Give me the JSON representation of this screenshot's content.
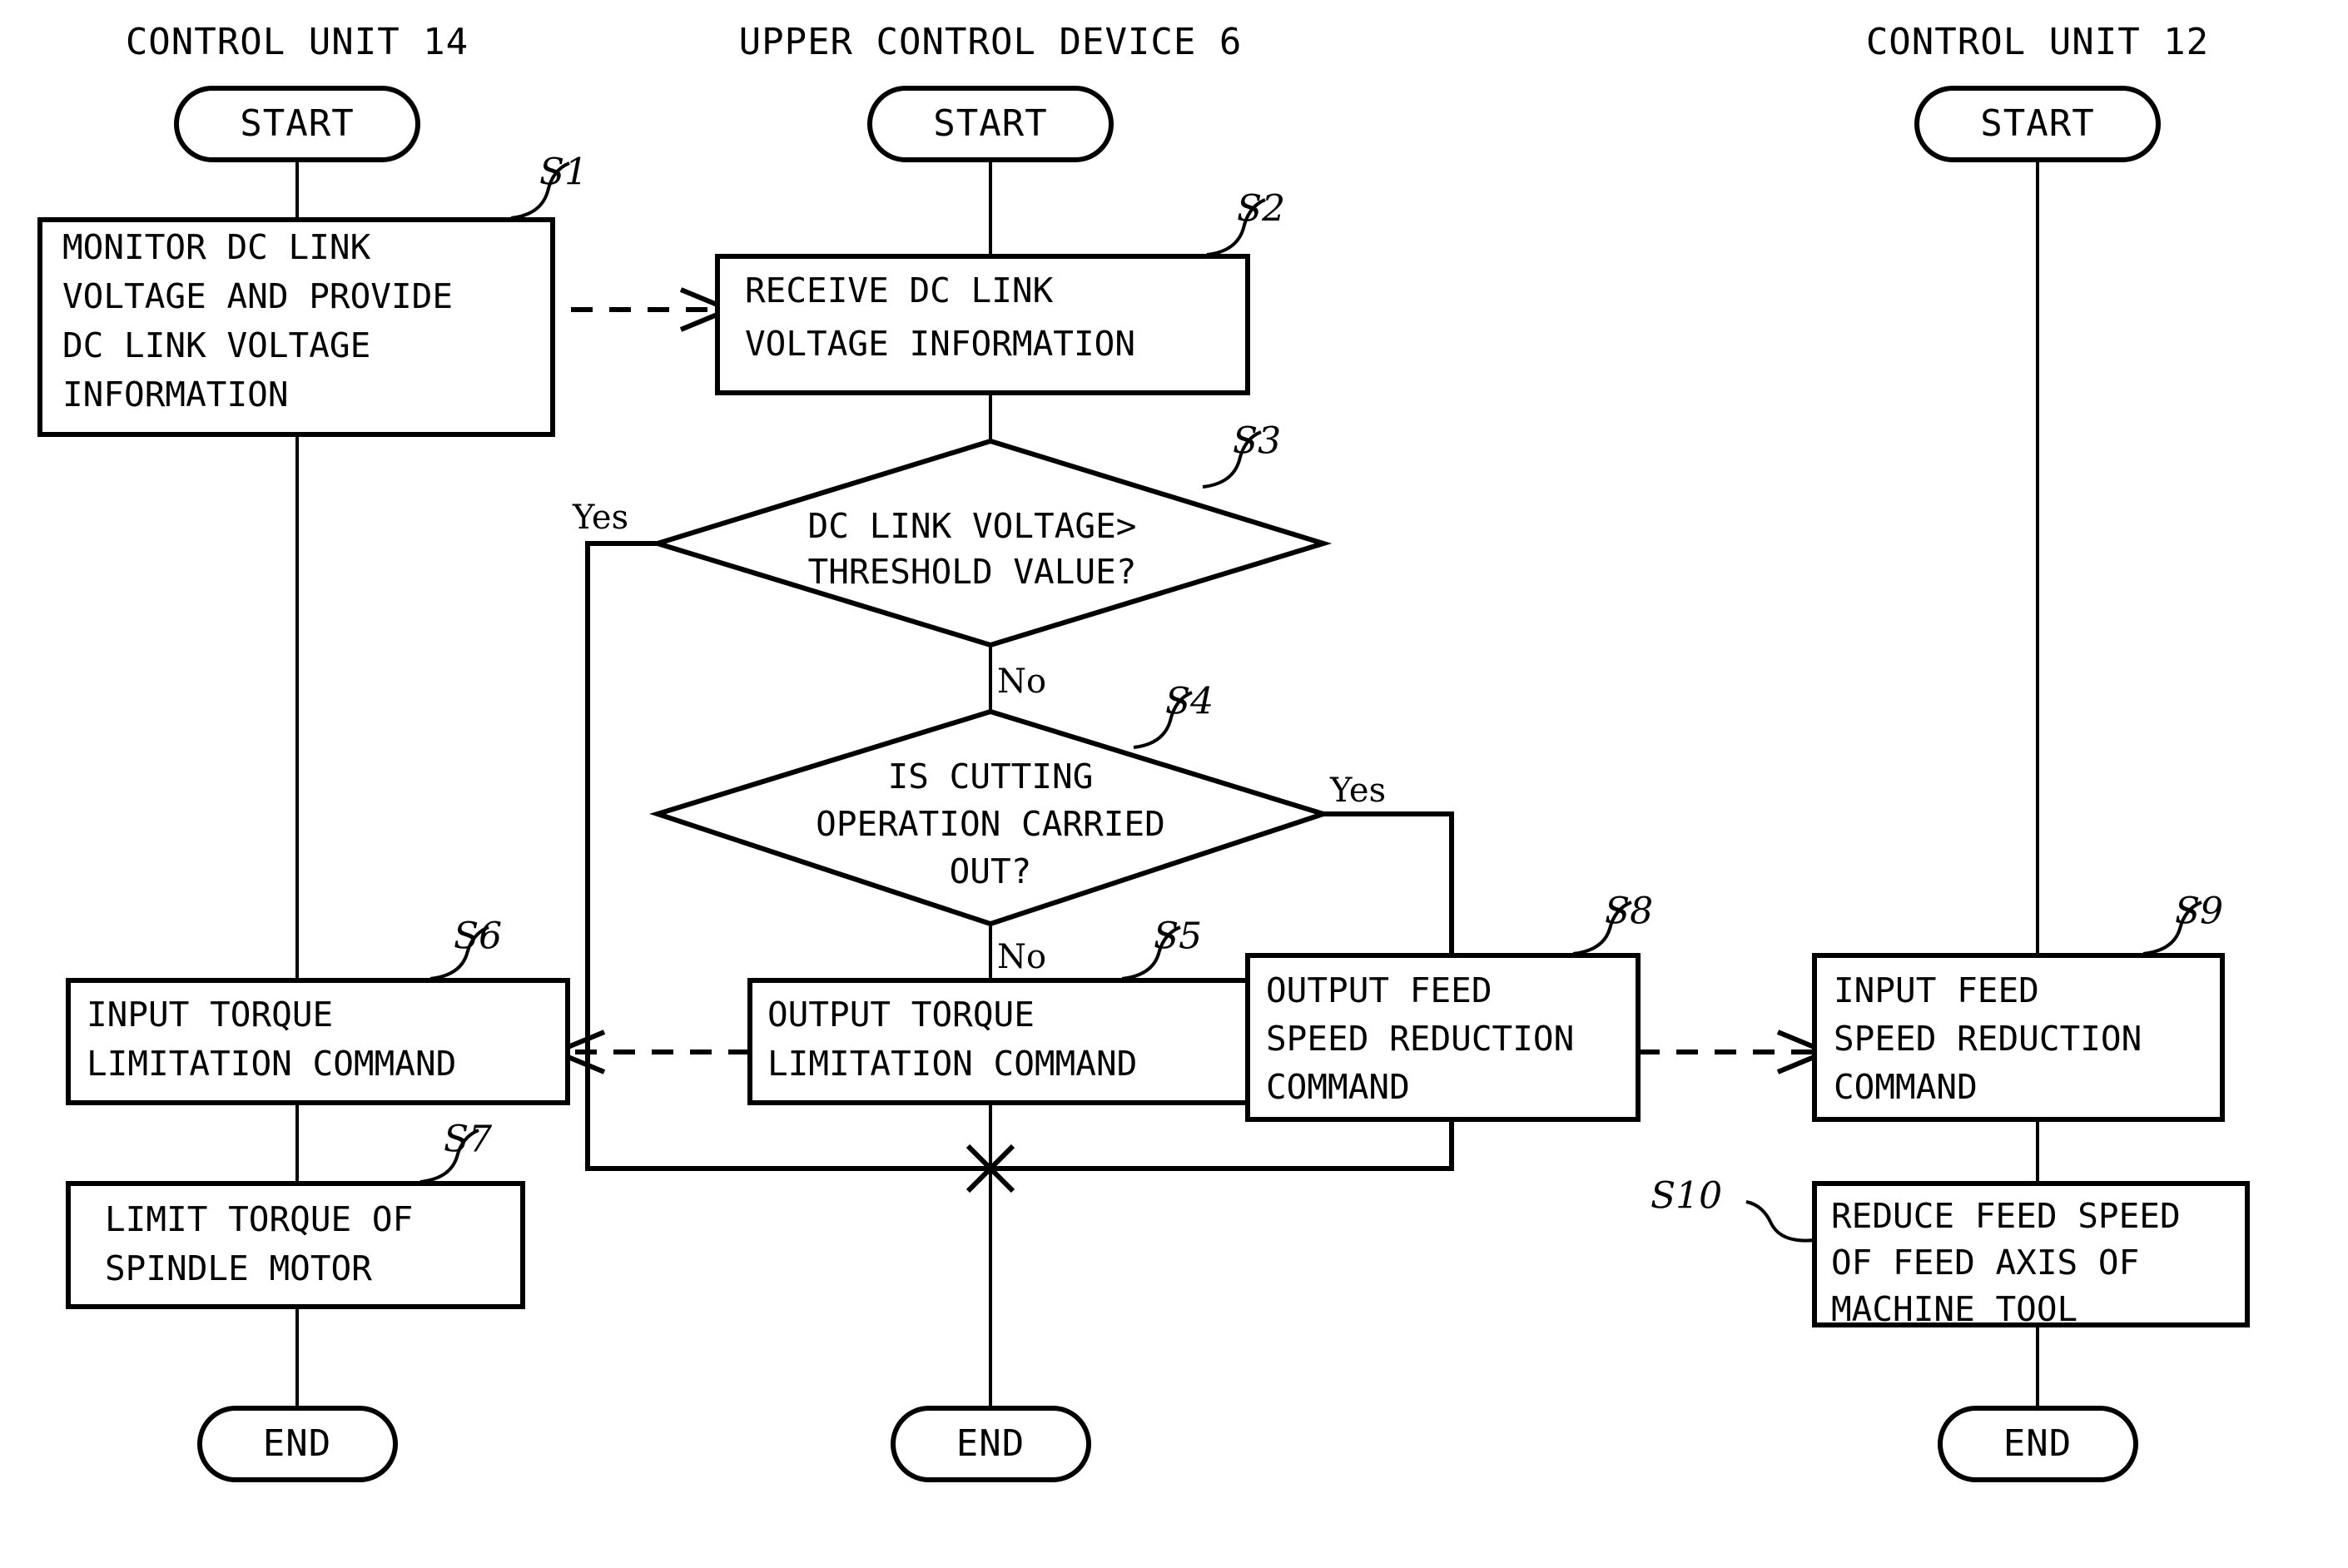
{
  "diagram": {
    "type": "flowchart",
    "title": "Patent flowchart: DC link voltage monitoring and torque/feed-speed limitation",
    "lanes": [
      {
        "id": "lane-left",
        "header": "CONTROL UNIT 14"
      },
      {
        "id": "lane-middle",
        "header": "UPPER CONTROL DEVICE 6"
      },
      {
        "id": "lane-right",
        "header": "CONTROL UNIT 12"
      }
    ],
    "terminals": {
      "start": "START",
      "end": "END"
    },
    "branch_labels": {
      "yes": "Yes",
      "no": "No"
    },
    "nodes": [
      {
        "id": "S1",
        "lane": "lane-left",
        "kind": "process",
        "step_label": "S1",
        "lines": [
          "MONITOR DC LINK",
          "VOLTAGE AND PROVIDE",
          "DC LINK VOLTAGE",
          "INFORMATION"
        ]
      },
      {
        "id": "S2",
        "lane": "lane-middle",
        "kind": "process",
        "step_label": "S2",
        "lines": [
          "RECEIVE DC LINK",
          "VOLTAGE INFORMATION"
        ]
      },
      {
        "id": "S3",
        "lane": "lane-middle",
        "kind": "decision",
        "step_label": "S3",
        "lines": [
          "DC LINK VOLTAGE>",
          "THRESHOLD VALUE?"
        ],
        "yes_direction": "left",
        "no_direction": "down"
      },
      {
        "id": "S4",
        "lane": "lane-middle",
        "kind": "decision",
        "step_label": "S4",
        "lines": [
          "IS CUTTING",
          "OPERATION CARRIED",
          "OUT?"
        ],
        "yes_direction": "right",
        "no_direction": "down"
      },
      {
        "id": "S5",
        "lane": "lane-middle",
        "kind": "process",
        "step_label": "S5",
        "lines": [
          "OUTPUT TORQUE",
          "LIMITATION COMMAND"
        ]
      },
      {
        "id": "S6",
        "lane": "lane-left",
        "kind": "process",
        "step_label": "S6",
        "lines": [
          "INPUT TORQUE",
          "LIMITATION COMMAND"
        ]
      },
      {
        "id": "S7",
        "lane": "lane-left",
        "kind": "process",
        "step_label": "S7",
        "lines": [
          "LIMIT TORQUE OF",
          "SPINDLE MOTOR"
        ]
      },
      {
        "id": "S8",
        "lane": "lane-middle",
        "kind": "process",
        "step_label": "S8",
        "lines": [
          "OUTPUT FEED",
          "SPEED REDUCTION",
          "COMMAND"
        ]
      },
      {
        "id": "S9",
        "lane": "lane-right",
        "kind": "process",
        "step_label": "S9",
        "lines": [
          "INPUT FEED",
          "SPEED REDUCTION",
          "COMMAND"
        ]
      },
      {
        "id": "S10",
        "lane": "lane-right",
        "kind": "process",
        "step_label": "S10",
        "lines": [
          "REDUCE FEED SPEED",
          "OF FEED AXIS OF",
          "MACHINE TOOL"
        ]
      }
    ],
    "edges": [
      {
        "from": "start-left",
        "to": "S1",
        "style": "solid"
      },
      {
        "from": "S1",
        "to": "S2",
        "style": "dashed",
        "arrow": "right"
      },
      {
        "from": "S1",
        "to": "S6",
        "style": "solid"
      },
      {
        "from": "start-middle",
        "to": "S2",
        "style": "solid"
      },
      {
        "from": "S2",
        "to": "S3",
        "style": "solid"
      },
      {
        "from": "S3",
        "to": "S4",
        "style": "solid",
        "label": "No"
      },
      {
        "from": "S3",
        "to": "merge",
        "style": "solid",
        "label": "Yes"
      },
      {
        "from": "S4",
        "to": "S5",
        "style": "solid",
        "label": "No"
      },
      {
        "from": "S4",
        "to": "S8",
        "style": "solid",
        "label": "Yes"
      },
      {
        "from": "S5",
        "to": "S6",
        "style": "dashed",
        "arrow": "left"
      },
      {
        "from": "S5",
        "to": "merge",
        "style": "solid"
      },
      {
        "from": "S8",
        "to": "merge",
        "style": "solid"
      },
      {
        "from": "S8",
        "to": "S9",
        "style": "dashed",
        "arrow": "right"
      },
      {
        "from": "merge",
        "to": "end-middle",
        "style": "solid"
      },
      {
        "from": "S6",
        "to": "S7",
        "style": "solid"
      },
      {
        "from": "S7",
        "to": "end-left",
        "style": "solid"
      },
      {
        "from": "start-right",
        "to": "S9",
        "style": "solid"
      },
      {
        "from": "S9",
        "to": "S10",
        "style": "solid"
      },
      {
        "from": "S10",
        "to": "end-right",
        "style": "solid"
      }
    ],
    "colors": {
      "ink": "#000000",
      "paper": "#ffffff"
    }
  }
}
